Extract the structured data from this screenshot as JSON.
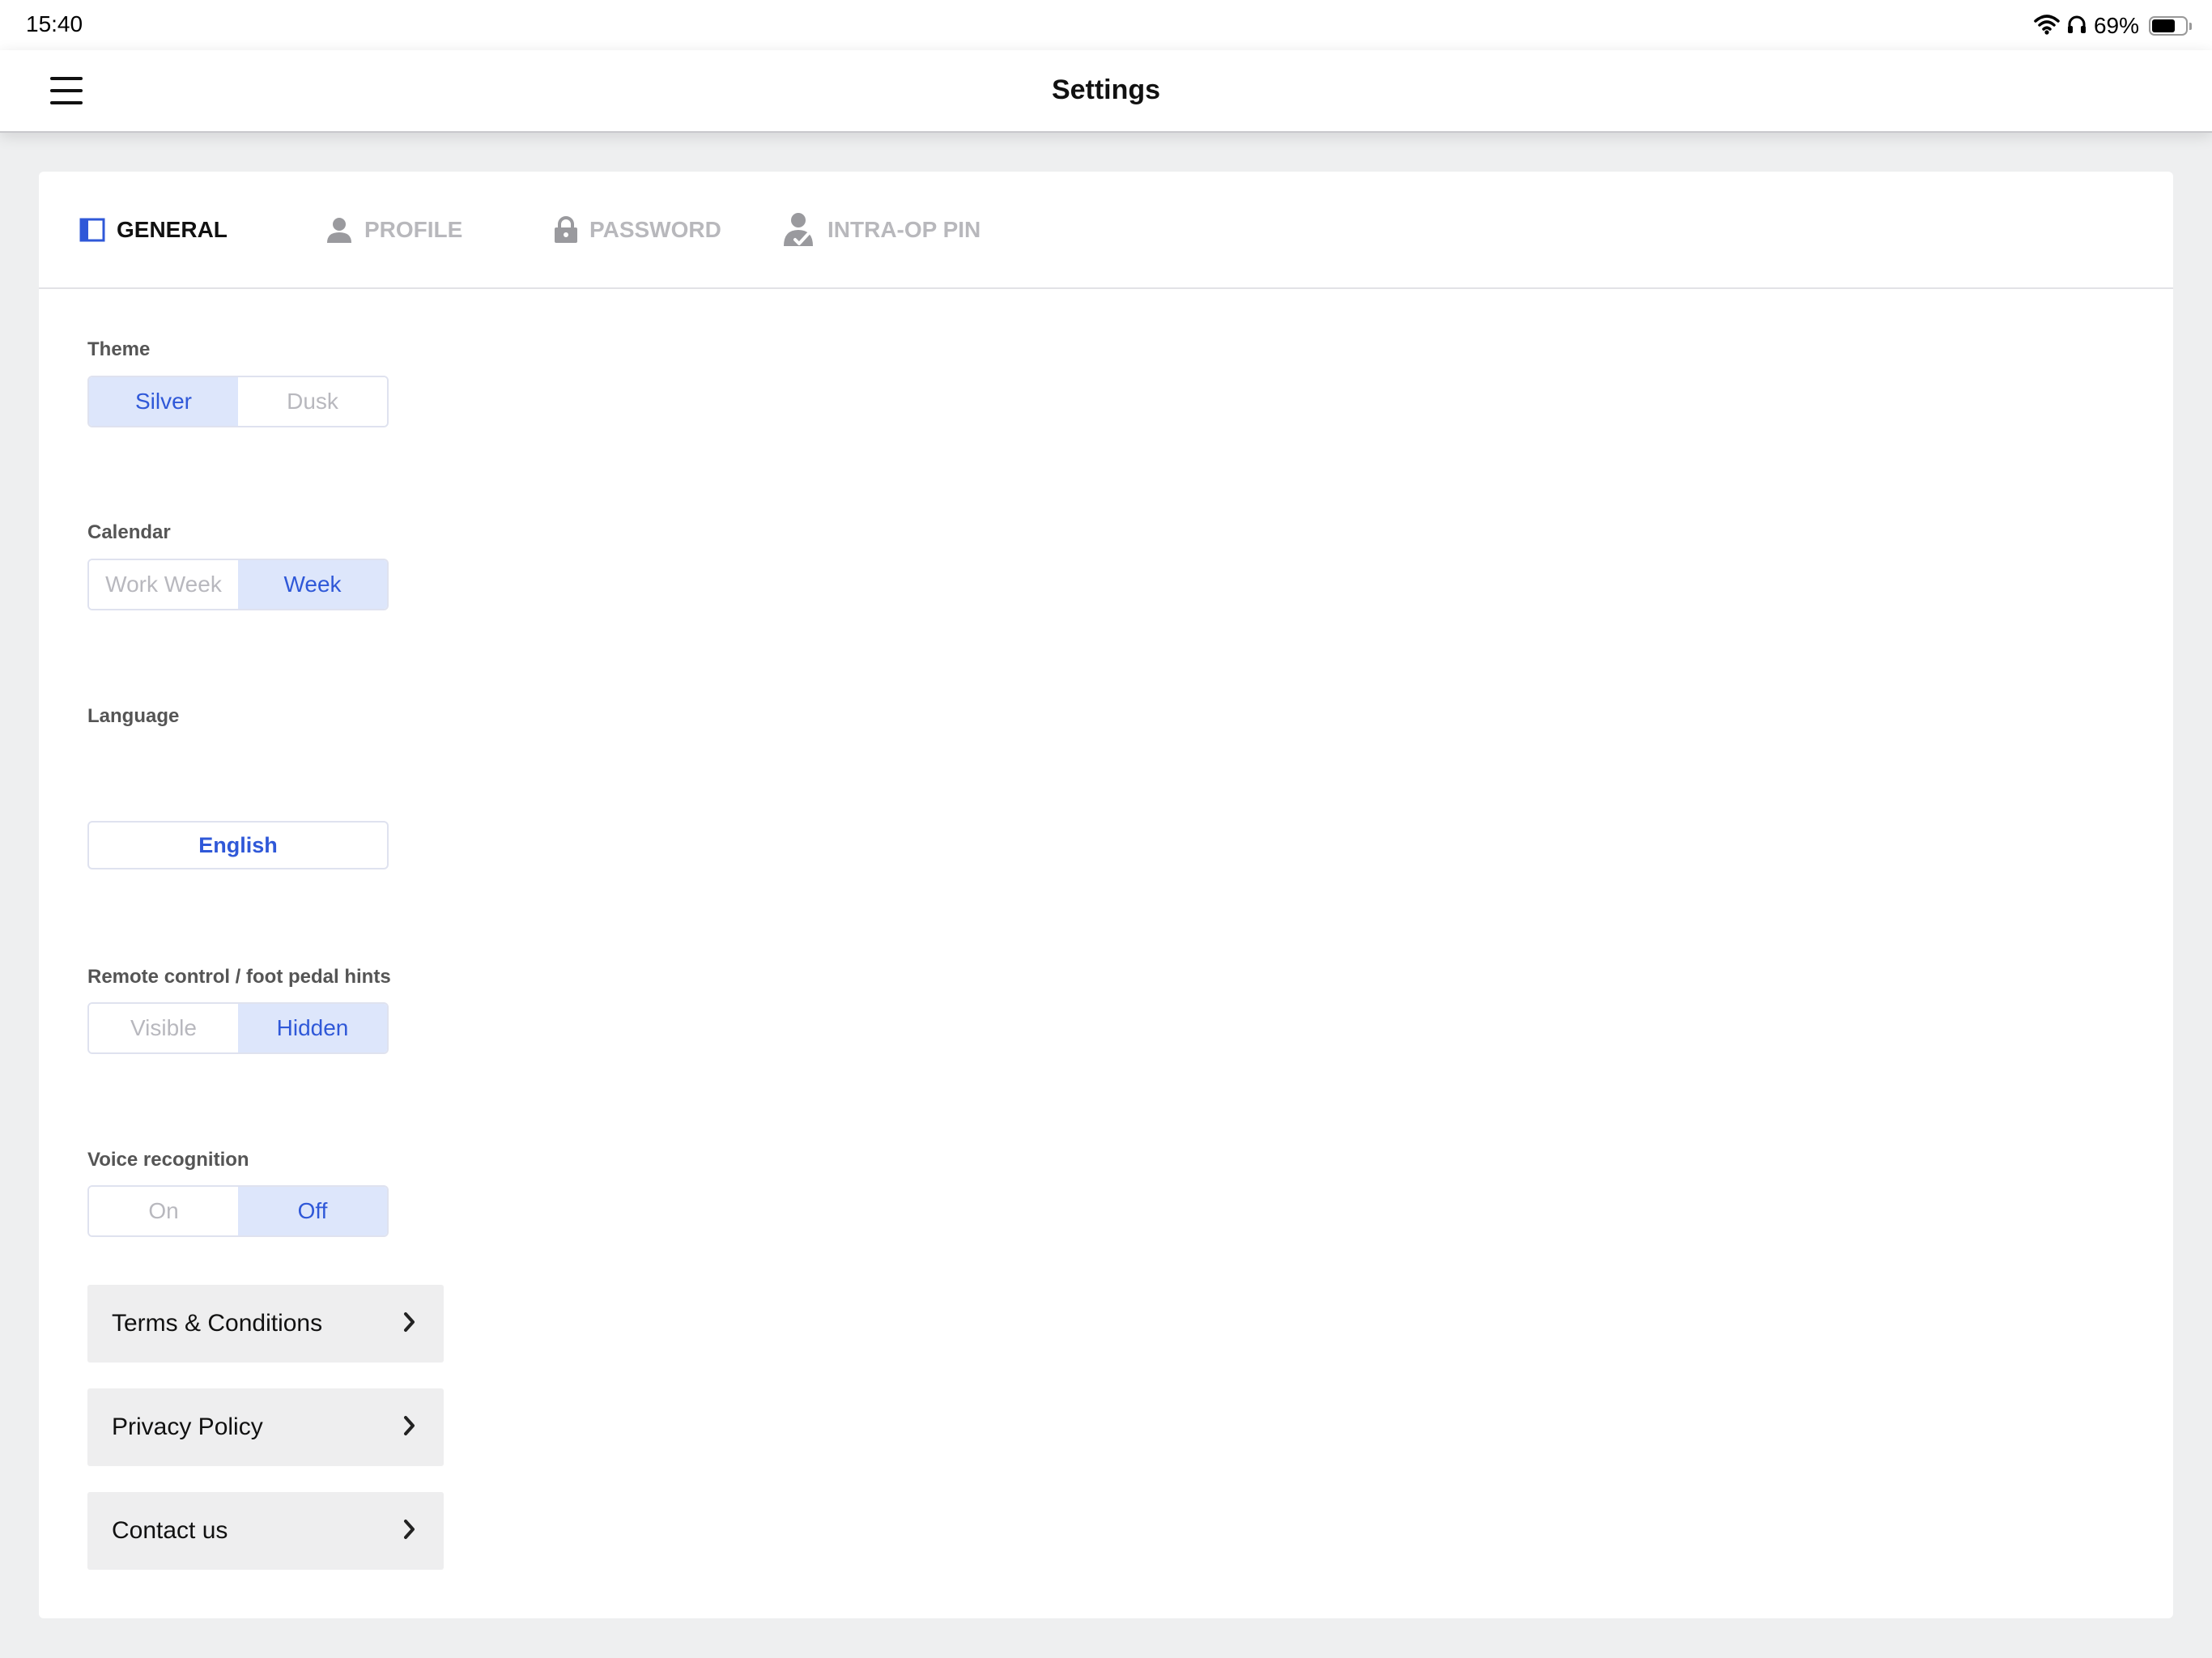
{
  "status_bar": {
    "time": "15:40",
    "battery_percent_label": "69%",
    "battery_level": 0.69,
    "icons": [
      "wifi-icon",
      "headphones-icon",
      "battery-icon"
    ]
  },
  "nav": {
    "title": "Settings",
    "menu_icon": "hamburger-menu-icon"
  },
  "tabs": [
    {
      "label": "GENERAL",
      "icon": "sidebar-panel-icon",
      "active": true
    },
    {
      "label": "PROFILE",
      "icon": "person-icon",
      "active": false
    },
    {
      "label": "PASSWORD",
      "icon": "lock-icon",
      "active": false
    },
    {
      "label": "INTRA-OP PIN",
      "icon": "person-check-icon",
      "active": false
    }
  ],
  "settings": {
    "theme": {
      "label": "Theme",
      "options": [
        "Silver",
        "Dusk"
      ],
      "selected": "Silver"
    },
    "calendar": {
      "label": "Calendar",
      "options": [
        "Work Week",
        "Week"
      ],
      "selected": "Week"
    },
    "language": {
      "label": "Language",
      "value": "English"
    },
    "hints": {
      "label": "Remote control / foot pedal hints",
      "options": [
        "Visible",
        "Hidden"
      ],
      "selected": "Hidden"
    },
    "voice": {
      "label": "Voice recognition",
      "options": [
        "On",
        "Off"
      ],
      "selected": "Off"
    }
  },
  "links": [
    {
      "label": "Terms & Conditions",
      "icon": "chevron-right-icon"
    },
    {
      "label": "Privacy Policy",
      "icon": "chevron-right-icon"
    },
    {
      "label": "Contact us",
      "icon": "chevron-right-icon"
    }
  ],
  "colors": {
    "accent": "#2f58d8",
    "selected_bg": "#dde6fb",
    "background": "#eeeff0",
    "inactive_text": "#b8b8be"
  }
}
